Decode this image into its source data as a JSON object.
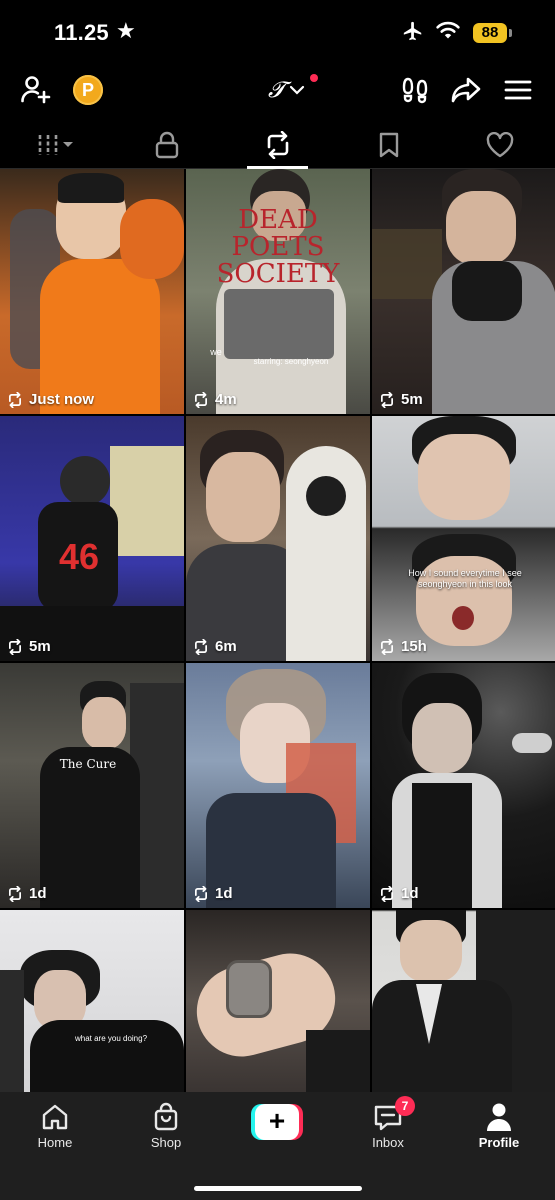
{
  "status_bar": {
    "time": "11.25",
    "battery": "88"
  },
  "header": {
    "coin_label": "P",
    "account_glyph": "𝓣"
  },
  "tabs": [
    "grid",
    "private",
    "reposts",
    "favorites",
    "liked"
  ],
  "grid": {
    "items": [
      {
        "meta": "Just now",
        "overlay": ""
      },
      {
        "meta": "4m",
        "overlay": "DEAD POETS SOCIETY",
        "overlay2": "starring: seonghyeon",
        "overlay3": "we"
      },
      {
        "meta": "5m",
        "overlay": ""
      },
      {
        "meta": "5m",
        "overlay": "46"
      },
      {
        "meta": "6m",
        "overlay": ""
      },
      {
        "meta": "15h",
        "overlay": "How I sound everytime I see seonghyeon in this look"
      },
      {
        "meta": "1d",
        "overlay": "The Cure"
      },
      {
        "meta": "1d",
        "overlay": ""
      },
      {
        "meta": "1d",
        "overlay": ""
      },
      {
        "meta": "",
        "overlay": "what are you doing?"
      },
      {
        "meta": "",
        "overlay": ""
      },
      {
        "meta": "",
        "overlay": ""
      }
    ]
  },
  "nav": {
    "home": "Home",
    "shop": "Shop",
    "create": "+",
    "inbox": "Inbox",
    "inbox_badge": "7",
    "profile": "Profile"
  },
  "colors": {
    "accent": "#fe2c55",
    "cyan": "#25f4ee",
    "coin": "#f2a91c",
    "battery": "#f2c322"
  }
}
